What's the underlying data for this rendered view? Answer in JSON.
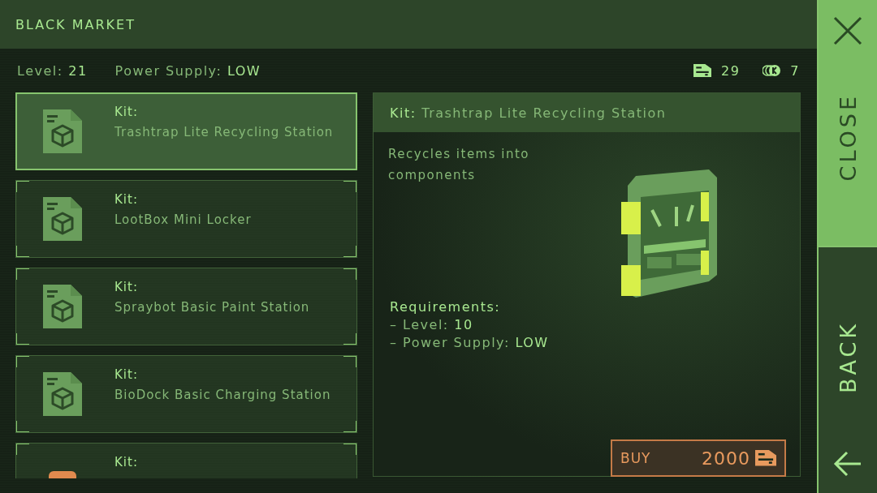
{
  "header": {
    "title": "BLACK MARKET"
  },
  "stats": {
    "level_label": "Level:",
    "level_value": "21",
    "power_label": "Power Supply:",
    "power_value": "LOW",
    "storage_count": "29",
    "coin_count": "7"
  },
  "items": [
    {
      "kind": "document",
      "prefix": "Kit:",
      "name": "Trashtrap Lite Recycling Station",
      "selected": true
    },
    {
      "kind": "document",
      "prefix": "Kit:",
      "name": "LootBox Mini Locker",
      "selected": false
    },
    {
      "kind": "document",
      "prefix": "Kit:",
      "name": "Spraybot Basic Paint Station",
      "selected": false
    },
    {
      "kind": "document",
      "prefix": "Kit:",
      "name": "BioDock Basic Charging Station",
      "selected": false
    },
    {
      "kind": "frame",
      "prefix": "Kit:",
      "selected": false
    }
  ],
  "detail": {
    "prefix": "Kit:",
    "title": "Trashtrap Lite Recycling Station",
    "description": "Recycles items into components",
    "requirements_title": "Requirements:",
    "requirements": [
      {
        "label": "– Level:",
        "value": "10"
      },
      {
        "label": "– Power Supply:",
        "value": "LOW"
      }
    ],
    "buy": {
      "label": "BUY",
      "price": "2000"
    }
  },
  "rail": [
    {
      "label": "CLOSE",
      "kind": "close",
      "selected": true
    },
    {
      "label": "BACK",
      "kind": "back",
      "selected": false
    }
  ]
}
